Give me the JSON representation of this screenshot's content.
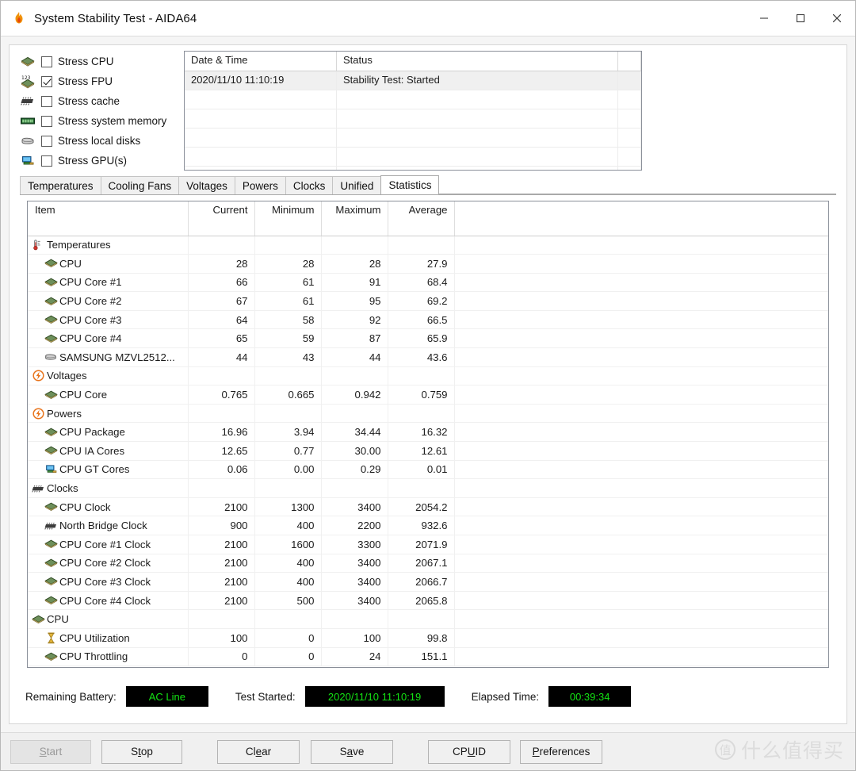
{
  "window": {
    "title": "System Stability Test - AIDA64",
    "app_icon": "flame-icon",
    "controls": {
      "minimize": "minimize-icon",
      "maximize": "maximize-icon",
      "close": "close-icon"
    }
  },
  "stress_options": [
    {
      "label": "Stress CPU",
      "checked": false,
      "icon": "cpu-icon"
    },
    {
      "label": "Stress FPU",
      "checked": true,
      "icon": "fpu-icon"
    },
    {
      "label": "Stress cache",
      "checked": false,
      "icon": "chip-icon"
    },
    {
      "label": "Stress system memory",
      "checked": false,
      "icon": "memory-icon"
    },
    {
      "label": "Stress local disks",
      "checked": false,
      "icon": "disk-icon"
    },
    {
      "label": "Stress GPU(s)",
      "checked": false,
      "icon": "gpu-icon"
    }
  ],
  "log": {
    "columns": [
      "Date & Time",
      "Status"
    ],
    "rows": [
      {
        "datetime": "2020/11/10 11:10:19",
        "status": "Stability Test: Started",
        "selected": true
      }
    ],
    "empty_rows": 5
  },
  "tabs": [
    {
      "label": "Temperatures",
      "active": false
    },
    {
      "label": "Cooling Fans",
      "active": false
    },
    {
      "label": "Voltages",
      "active": false
    },
    {
      "label": "Powers",
      "active": false
    },
    {
      "label": "Clocks",
      "active": false
    },
    {
      "label": "Unified",
      "active": false
    },
    {
      "label": "Statistics",
      "active": true
    }
  ],
  "statistics": {
    "columns": [
      "Item",
      "Current",
      "Minimum",
      "Maximum",
      "Average"
    ],
    "rows": [
      {
        "type": "group",
        "icon": "thermometer-icon",
        "item": "Temperatures",
        "current": "",
        "minimum": "",
        "maximum": "",
        "average": ""
      },
      {
        "type": "child",
        "icon": "cpu-icon",
        "item": "CPU",
        "current": "28",
        "minimum": "28",
        "maximum": "28",
        "average": "27.9"
      },
      {
        "type": "child",
        "icon": "cpu-icon",
        "item": "CPU Core #1",
        "current": "66",
        "minimum": "61",
        "maximum": "91",
        "average": "68.4"
      },
      {
        "type": "child",
        "icon": "cpu-icon",
        "item": "CPU Core #2",
        "current": "67",
        "minimum": "61",
        "maximum": "95",
        "average": "69.2"
      },
      {
        "type": "child",
        "icon": "cpu-icon",
        "item": "CPU Core #3",
        "current": "64",
        "minimum": "58",
        "maximum": "92",
        "average": "66.5"
      },
      {
        "type": "child",
        "icon": "cpu-icon",
        "item": "CPU Core #4",
        "current": "65",
        "minimum": "59",
        "maximum": "87",
        "average": "65.9"
      },
      {
        "type": "child",
        "icon": "disk-icon",
        "item": "SAMSUNG MZVL2512...",
        "current": "44",
        "minimum": "43",
        "maximum": "44",
        "average": "43.6"
      },
      {
        "type": "group",
        "icon": "bolt-icon",
        "item": "Voltages",
        "current": "",
        "minimum": "",
        "maximum": "",
        "average": ""
      },
      {
        "type": "child",
        "icon": "cpu-icon",
        "item": "CPU Core",
        "current": "0.765",
        "minimum": "0.665",
        "maximum": "0.942",
        "average": "0.759"
      },
      {
        "type": "group",
        "icon": "bolt-icon",
        "item": "Powers",
        "current": "",
        "minimum": "",
        "maximum": "",
        "average": ""
      },
      {
        "type": "child",
        "icon": "cpu-icon",
        "item": "CPU Package",
        "current": "16.96",
        "minimum": "3.94",
        "maximum": "34.44",
        "average": "16.32"
      },
      {
        "type": "child",
        "icon": "cpu-icon",
        "item": "CPU IA Cores",
        "current": "12.65",
        "minimum": "0.77",
        "maximum": "30.00",
        "average": "12.61"
      },
      {
        "type": "child",
        "icon": "gpu-icon",
        "item": "CPU GT Cores",
        "current": "0.06",
        "minimum": "0.00",
        "maximum": "0.29",
        "average": "0.01"
      },
      {
        "type": "group",
        "icon": "chip-icon",
        "item": "Clocks",
        "current": "",
        "minimum": "",
        "maximum": "",
        "average": ""
      },
      {
        "type": "child",
        "icon": "cpu-icon",
        "item": "CPU Clock",
        "current": "2100",
        "minimum": "1300",
        "maximum": "3400",
        "average": "2054.2"
      },
      {
        "type": "child",
        "icon": "chip-icon",
        "item": "North Bridge Clock",
        "current": "900",
        "minimum": "400",
        "maximum": "2200",
        "average": "932.6"
      },
      {
        "type": "child",
        "icon": "cpu-icon",
        "item": "CPU Core #1 Clock",
        "current": "2100",
        "minimum": "1600",
        "maximum": "3300",
        "average": "2071.9"
      },
      {
        "type": "child",
        "icon": "cpu-icon",
        "item": "CPU Core #2 Clock",
        "current": "2100",
        "minimum": "400",
        "maximum": "3400",
        "average": "2067.1"
      },
      {
        "type": "child",
        "icon": "cpu-icon",
        "item": "CPU Core #3 Clock",
        "current": "2100",
        "minimum": "400",
        "maximum": "3400",
        "average": "2066.7"
      },
      {
        "type": "child",
        "icon": "cpu-icon",
        "item": "CPU Core #4 Clock",
        "current": "2100",
        "minimum": "500",
        "maximum": "3400",
        "average": "2065.8"
      },
      {
        "type": "group",
        "icon": "cpu-icon",
        "item": "CPU",
        "current": "",
        "minimum": "",
        "maximum": "",
        "average": ""
      },
      {
        "type": "child",
        "icon": "hourglass-icon",
        "item": "CPU Utilization",
        "current": "100",
        "minimum": "0",
        "maximum": "100",
        "average": "99.8"
      },
      {
        "type": "child",
        "icon": "cpu-icon",
        "item": "CPU Throttling",
        "current": "0",
        "minimum": "0",
        "maximum": "24",
        "average": "151.1"
      }
    ]
  },
  "status_fields": [
    {
      "label": "Remaining Battery:",
      "value": "AC Line",
      "width_class": "w-battery"
    },
    {
      "label": "Test Started:",
      "value": "2020/11/10 11:10:19",
      "width_class": "w-started"
    },
    {
      "label": "Elapsed Time:",
      "value": "00:39:34",
      "width_class": "w-elapsed"
    }
  ],
  "buttons": [
    {
      "name": "start",
      "label": "Start",
      "accel": "S",
      "disabled": true,
      "width_class": "w-start"
    },
    {
      "name": "stop",
      "label": "Stop",
      "accel": "t",
      "disabled": false,
      "width_class": "w-stop"
    },
    {
      "name": "clear",
      "label": "Clear",
      "accel": "e",
      "disabled": false,
      "width_class": "w-clear"
    },
    {
      "name": "save",
      "label": "Save",
      "accel": "a",
      "disabled": false,
      "width_class": "w-save"
    },
    {
      "name": "cpuid",
      "label": "CPUID",
      "accel": "U",
      "disabled": false,
      "width_class": "w-cpuid"
    },
    {
      "name": "preferences",
      "label": "Preferences",
      "accel": "P",
      "disabled": false,
      "width_class": "w-pref"
    }
  ],
  "watermark": {
    "logo_char": "值",
    "text": "什么值得买"
  },
  "colors": {
    "led_background": "#000000",
    "led_text": "#13e313",
    "window_background": "#ffffff",
    "client_background": "#f5f5f5",
    "accent_bolt": "#e8741c"
  }
}
